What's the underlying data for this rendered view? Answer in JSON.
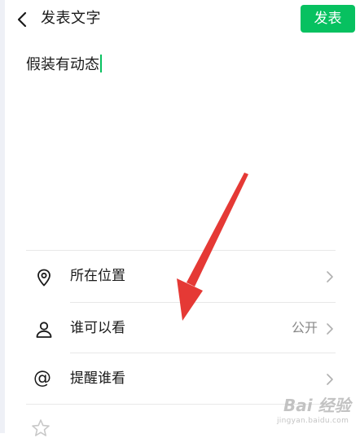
{
  "header": {
    "title": "发表文字",
    "publish_label": "发表"
  },
  "editor": {
    "text": "假装有动态"
  },
  "options": [
    {
      "label": "所在位置",
      "icon": "location-pin-icon",
      "value": ""
    },
    {
      "label": "谁可以看",
      "icon": "person-icon",
      "value": "公开"
    },
    {
      "label": "提醒谁看",
      "icon": "at-sign-icon",
      "value": ""
    }
  ],
  "watermark": {
    "brand": "Bai 经验",
    "site": "jingyan.baidu.com"
  },
  "colors": {
    "accent": "#07c160",
    "annotation": "#e53935"
  }
}
